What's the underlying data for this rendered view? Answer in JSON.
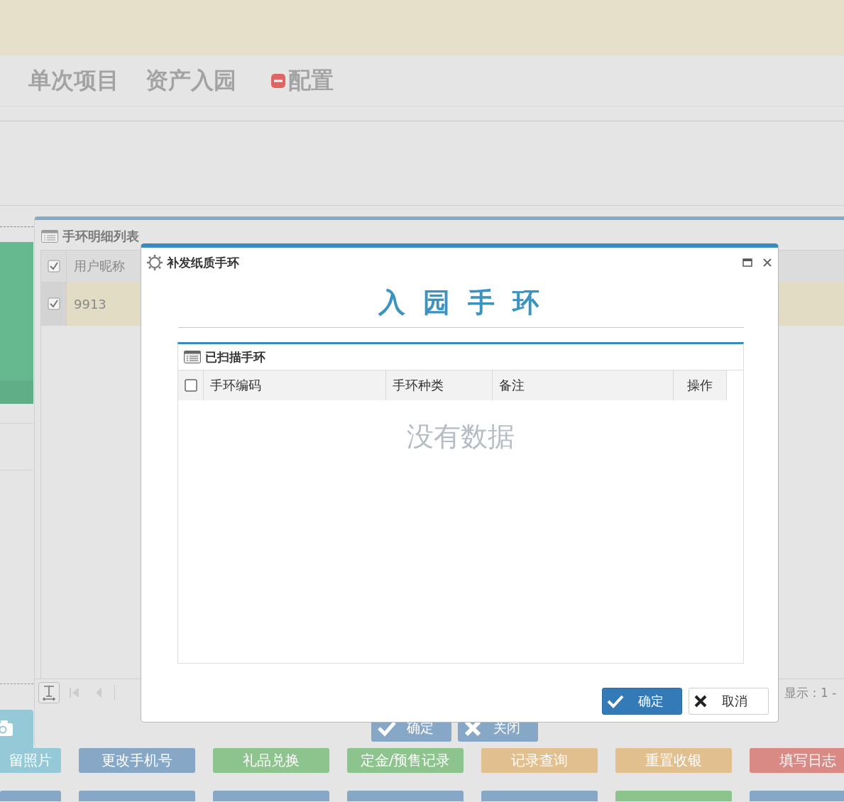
{
  "nav": {
    "tabs": [
      {
        "label": "单次项目",
        "removable": false
      },
      {
        "label": "资产入园",
        "removable": false
      },
      {
        "label": "配置",
        "removable": true
      }
    ]
  },
  "list_window": {
    "title": "手环明细列表",
    "all_checked": true,
    "columns": [
      "用户昵称"
    ],
    "rows": [
      {
        "cells": [
          "9913"
        ],
        "checked": true
      }
    ],
    "pager": {
      "display": "显示：1 -"
    },
    "buttons": [
      {
        "label": "确定",
        "kind": "confirm"
      },
      {
        "label": "关闭",
        "kind": "close"
      }
    ]
  },
  "action_buttons": [
    {
      "label": "留照片",
      "color": "#96c9d8"
    },
    {
      "label": "更改手机号",
      "color": "#86a7c6"
    },
    {
      "label": "礼品兑换",
      "color": "#8dc48d"
    },
    {
      "label": "定金/预售记录",
      "color": "#8dc48d"
    },
    {
      "label": "记录查询",
      "color": "#e1bf8f"
    },
    {
      "label": "重置收银",
      "color": "#e1bf8f"
    },
    {
      "label": "填写日志",
      "color": "#d98a85"
    }
  ],
  "tiles": [
    {
      "color": "#86a7c6"
    },
    {
      "color": "#86a7c6"
    },
    {
      "color": "#86a7c6"
    },
    {
      "color": "#86a7c6"
    },
    {
      "color": "#86a7c6"
    },
    {
      "color": "#8dc48d"
    },
    {
      "color": "#86a7c6"
    }
  ],
  "dialog": {
    "title": "补发纸质手环",
    "heading": "入 园 手 环",
    "panel": {
      "title": "已扫描手环",
      "all_checked": false,
      "columns": [
        "手环编码",
        "手环种类",
        "备注",
        "操作"
      ],
      "empty_text": "没有数据"
    },
    "buttons": [
      {
        "label": "确定",
        "kind": "primary"
      },
      {
        "label": "取消",
        "kind": "secondary"
      }
    ]
  }
}
